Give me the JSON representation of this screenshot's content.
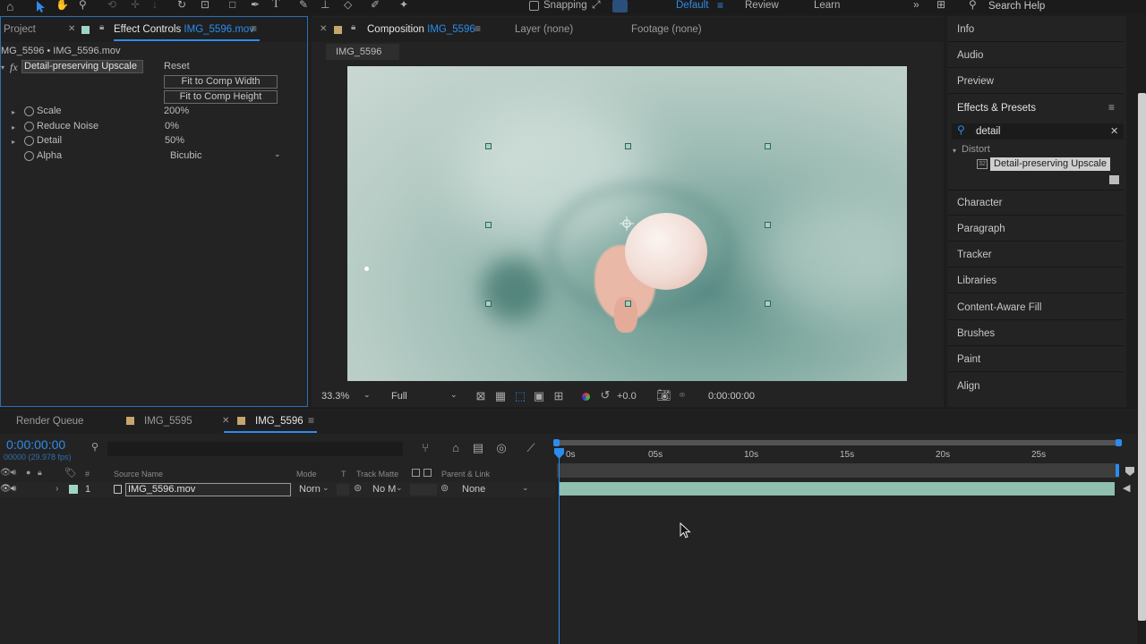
{
  "toolbar": {
    "snapping_label": "Snapping",
    "workspaces": [
      "Default",
      "Review",
      "Learn"
    ],
    "active_workspace": "Default",
    "search_placeholder": "Search Help",
    "more_glyph": "»"
  },
  "project_panel": {
    "tab_project": "Project",
    "tab_effect_controls": "Effect Controls",
    "effect_controls_layer": "IMG_5596.mov",
    "breadcrumb": "MG_5596 • IMG_5596.mov",
    "effect_badge": "fx",
    "effect_name": "Detail-preserving Upscale",
    "reset_label": "Reset",
    "fit_width_label": "Fit to Comp Width",
    "fit_height_label": "Fit to Comp Height",
    "properties": [
      {
        "name": "Scale",
        "value": "200",
        "unit": "%"
      },
      {
        "name": "Reduce Noise",
        "value": "0",
        "unit": "%"
      },
      {
        "name": "Detail",
        "value": "50",
        "unit": "%"
      },
      {
        "name": "Alpha",
        "value": "Bicubic",
        "unit": ""
      }
    ]
  },
  "composition_panel": {
    "tab_composition": "Composition",
    "comp_name": "IMG_5596",
    "tab_layer": "Layer (none)",
    "tab_footage": "Footage (none)",
    "subtab": "IMG_5596",
    "zoom": "33.3%",
    "resolution": "Full",
    "exposure": "+0.0",
    "timecode": "0:00:00:00"
  },
  "right_panel": {
    "items_top": [
      "Info",
      "Audio",
      "Preview"
    ],
    "effects_presets_title": "Effects & Presets",
    "search_value": "detail",
    "category": "Distort",
    "result": "Detail-preserving Upscale",
    "items_bottom": [
      "Character",
      "Paragraph",
      "Tracker",
      "Libraries",
      "Content-Aware Fill",
      "Brushes",
      "Paint",
      "Align"
    ]
  },
  "timeline": {
    "tab_render_queue": "Render Queue",
    "tab_comp_1": "IMG_5595",
    "tab_comp_2": "IMG_5596",
    "timecode": "0:00:00:00",
    "frame_info": "00000 (29.978 fps)",
    "columns": {
      "hash": "#",
      "source_name": "Source Name",
      "mode": "Mode",
      "t": "T",
      "track_matte": "Track Matte",
      "parent": "Parent & Link"
    },
    "layer": {
      "index": "1",
      "name": "IMG_5596.mov",
      "mode": "Norn",
      "track_matte": "No M",
      "parent": "None"
    },
    "ruler_ticks": [
      "0s",
      "05s",
      "10s",
      "15s",
      "20s",
      "25s"
    ]
  },
  "colors": {
    "accent_blue": "#2d8ceb",
    "layer_bar": "#8fbfae",
    "label_color": "#9fd4c4"
  }
}
